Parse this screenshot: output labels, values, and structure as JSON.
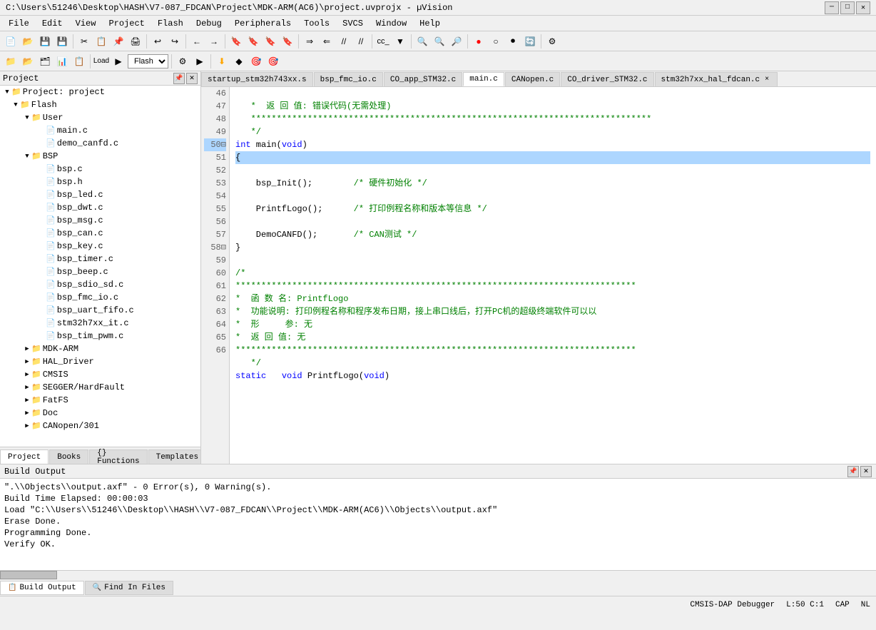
{
  "titlebar": {
    "title": "C:\\Users\\51246\\Desktop\\HASH\\V7-087_FDCAN\\Project\\MDK-ARM(AC6)\\project.uvprojx - µVision",
    "minimize": "─",
    "maximize": "□",
    "close": "✕"
  },
  "menubar": {
    "items": [
      "File",
      "Edit",
      "View",
      "Project",
      "Flash",
      "Debug",
      "Peripherals",
      "Tools",
      "SVCS",
      "Window",
      "Help"
    ]
  },
  "toolbar2": {
    "flash_label": "Flash"
  },
  "project_panel": {
    "title": "Project",
    "items": [
      {
        "id": "root",
        "label": "Project: project",
        "indent": 0,
        "type": "root",
        "expanded": true
      },
      {
        "id": "flash",
        "label": "Flash",
        "indent": 1,
        "type": "folder",
        "expanded": true
      },
      {
        "id": "user",
        "label": "User",
        "indent": 2,
        "type": "folder",
        "expanded": true
      },
      {
        "id": "main_c",
        "label": "main.c",
        "indent": 3,
        "type": "file"
      },
      {
        "id": "demo_canfd_c",
        "label": "demo_canfd.c",
        "indent": 3,
        "type": "file"
      },
      {
        "id": "bsp",
        "label": "BSP",
        "indent": 2,
        "type": "folder",
        "expanded": true
      },
      {
        "id": "bsp_c",
        "label": "bsp.c",
        "indent": 3,
        "type": "file"
      },
      {
        "id": "bsp_h",
        "label": "bsp.h",
        "indent": 3,
        "type": "file"
      },
      {
        "id": "bsp_led_c",
        "label": "bsp_led.c",
        "indent": 3,
        "type": "file"
      },
      {
        "id": "bsp_dwt_c",
        "label": "bsp_dwt.c",
        "indent": 3,
        "type": "file"
      },
      {
        "id": "bsp_msg_c",
        "label": "bsp_msg.c",
        "indent": 3,
        "type": "file"
      },
      {
        "id": "bsp_can_c",
        "label": "bsp_can.c",
        "indent": 3,
        "type": "file"
      },
      {
        "id": "bsp_key_c",
        "label": "bsp_key.c",
        "indent": 3,
        "type": "file"
      },
      {
        "id": "bsp_timer_c",
        "label": "bsp_timer.c",
        "indent": 3,
        "type": "file"
      },
      {
        "id": "bsp_beep_c",
        "label": "bsp_beep.c",
        "indent": 3,
        "type": "file"
      },
      {
        "id": "bsp_sdio_sd_c",
        "label": "bsp_sdio_sd.c",
        "indent": 3,
        "type": "file"
      },
      {
        "id": "bsp_fmc_io_c",
        "label": "bsp_fmc_io.c",
        "indent": 3,
        "type": "file"
      },
      {
        "id": "bsp_uart_fifo_c",
        "label": "bsp_uart_fifo.c",
        "indent": 3,
        "type": "file"
      },
      {
        "id": "stm32h7xx_it_c",
        "label": "stm32h7xx_it.c",
        "indent": 3,
        "type": "file"
      },
      {
        "id": "bsp_tim_pwm_c",
        "label": "bsp_tim_pwm.c",
        "indent": 3,
        "type": "file"
      },
      {
        "id": "mdk_arm",
        "label": "MDK-ARM",
        "indent": 2,
        "type": "folder",
        "expanded": false
      },
      {
        "id": "hal_driver",
        "label": "HAL_Driver",
        "indent": 2,
        "type": "folder",
        "expanded": false
      },
      {
        "id": "cmsis",
        "label": "CMSIS",
        "indent": 2,
        "type": "folder",
        "expanded": false
      },
      {
        "id": "segger",
        "label": "SEGGER/HardFault",
        "indent": 2,
        "type": "folder",
        "expanded": false
      },
      {
        "id": "fatfs",
        "label": "FatFS",
        "indent": 2,
        "type": "folder",
        "expanded": false
      },
      {
        "id": "doc",
        "label": "Doc",
        "indent": 2,
        "type": "folder",
        "expanded": false
      },
      {
        "id": "canopen",
        "label": "CANopen/301",
        "indent": 2,
        "type": "folder",
        "expanded": false
      }
    ]
  },
  "project_bottom_tabs": [
    {
      "id": "project",
      "label": "Project",
      "active": true
    },
    {
      "id": "books",
      "label": "Books",
      "active": false
    },
    {
      "id": "functions",
      "label": "Functions",
      "active": false
    },
    {
      "id": "templates",
      "label": "Templates",
      "active": false
    }
  ],
  "tabs": [
    {
      "id": "startup",
      "label": "startup_stm32h743xx.s",
      "active": false,
      "closeable": false
    },
    {
      "id": "bsp_fmc",
      "label": "bsp_fmc_io.c",
      "active": false,
      "closeable": false
    },
    {
      "id": "co_app",
      "label": "CO_app_STM32.c",
      "active": false,
      "closeable": false
    },
    {
      "id": "main",
      "label": "main.c",
      "active": true,
      "closeable": false
    },
    {
      "id": "canopen",
      "label": "CANopen.c",
      "active": false,
      "closeable": false
    },
    {
      "id": "co_driver",
      "label": "CO_driver_STM32.c",
      "active": false,
      "closeable": false
    },
    {
      "id": "stm32hal",
      "label": "stm32h7xx_hal_fdcan.c",
      "active": false,
      "closeable": false
    }
  ],
  "code": {
    "lines": [
      {
        "num": 46,
        "content": "   *  返 回 值: 错误代码(无需处理)",
        "type": "comment"
      },
      {
        "num": 47,
        "content": "   ******************************************************************************",
        "type": "comment"
      },
      {
        "num": 48,
        "content": "   */",
        "type": "comment"
      },
      {
        "num": 49,
        "content": "int main(void)",
        "type": "code"
      },
      {
        "num": 50,
        "content": "{",
        "type": "bracket",
        "highlight": true
      },
      {
        "num": 51,
        "content": "    bsp_Init();        /* 硬件初始化 */",
        "type": "code"
      },
      {
        "num": 52,
        "content": "",
        "type": "blank"
      },
      {
        "num": 53,
        "content": "    PrintfLogo();      /* 打印例程名称和版本等信息 */",
        "type": "code"
      },
      {
        "num": 54,
        "content": "",
        "type": "blank"
      },
      {
        "num": 55,
        "content": "    DemoCANFD();       /* CAN测试 */",
        "type": "code"
      },
      {
        "num": 56,
        "content": "}",
        "type": "bracket"
      },
      {
        "num": 57,
        "content": "",
        "type": "blank"
      },
      {
        "num": 58,
        "content": "/*",
        "type": "comment"
      },
      {
        "num": 59,
        "content": "******************************************************************************",
        "type": "comment"
      },
      {
        "num": 60,
        "content": "*  函 数 名: PrintfLogo",
        "type": "comment"
      },
      {
        "num": 61,
        "content": "*  功能说明: 打印例程名称和程序发布日期，接上串口线后，打开PC机的超级终端软件可以以",
        "type": "comment"
      },
      {
        "num": 62,
        "content": "*  形     参: 无",
        "type": "comment"
      },
      {
        "num": 63,
        "content": "*  返 回 值: 无",
        "type": "comment"
      },
      {
        "num": 64,
        "content": "******************************************************************************",
        "type": "comment"
      },
      {
        "num": 65,
        "content": "   */",
        "type": "comment"
      },
      {
        "num": 66,
        "content": "static   void PrintfLogo(void)",
        "type": "code"
      }
    ]
  },
  "build_output": {
    "title": "Build Output",
    "content": "\".\\Objects\\output.axf\" - 0 Error(s), 0 Warning(s).\nBuild Time Elapsed:  00:00:03\nLoad \"C:\\\\Users\\\\51246\\\\Desktop\\\\HASH\\\\V7-087_FDCAN\\\\Project\\\\MDK-ARM(AC6)\\\\Objects\\\\output.axf\"\nErase Done.\nProgramming Done.\nVerify OK."
  },
  "output_tabs": [
    {
      "id": "build",
      "label": "Build Output",
      "active": true
    },
    {
      "id": "find",
      "label": "Find In Files",
      "active": false
    }
  ],
  "statusbar": {
    "debugger": "CMSIS-DAP Debugger",
    "position": "L:50 C:1",
    "caps": "CAP",
    "nl": "NL"
  }
}
